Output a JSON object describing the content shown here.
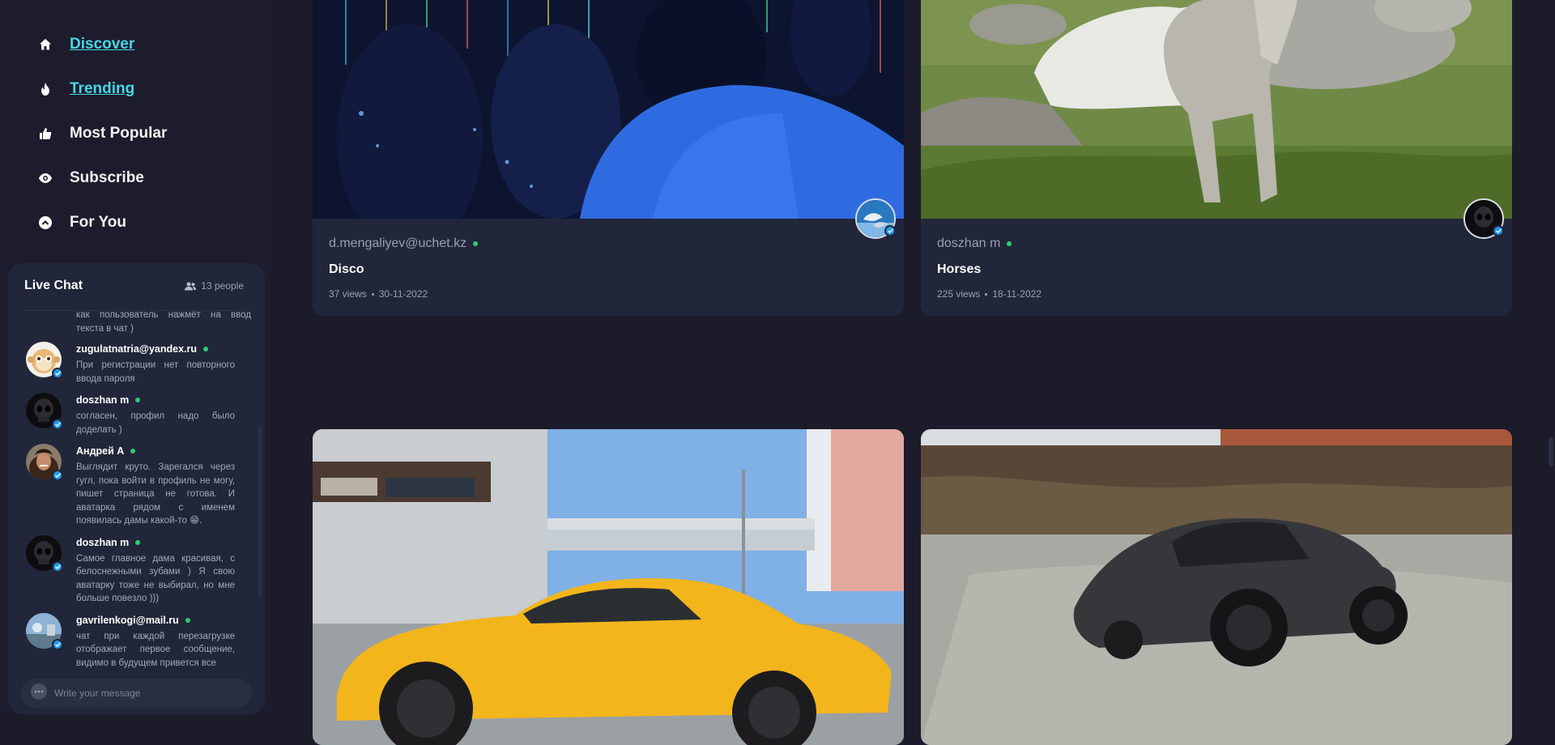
{
  "nav": {
    "items": [
      {
        "label": "Discover",
        "icon": "home-icon"
      },
      {
        "label": "Trending",
        "icon": "flame-icon"
      },
      {
        "label": "Most Popular",
        "icon": "thumbs-up-icon"
      },
      {
        "label": "Subscribe",
        "icon": "eye-icon"
      },
      {
        "label": "For You",
        "icon": "chevron-up-circle-icon"
      }
    ]
  },
  "chat": {
    "title": "Live Chat",
    "people_count": "13 people",
    "fragment": "как пользователь нажмёт на ввод текста в чат )",
    "messages": [
      {
        "user": "zugulatnatria@yandex.ru",
        "text": "При регистрации нет повторного ввода пароля",
        "avatar": "monkey-avatar"
      },
      {
        "user": "doszhan m",
        "text": "согласен, профил надо было доделать )",
        "avatar": "skull-avatar"
      },
      {
        "user": "Андрей А",
        "text": "Выглядит круто. Зарегался через гугл, пока войти в профиль не могу, пишет страница не готова. И аватарка рядом с именем появилась дамы какой-то 😁.",
        "avatar": "woman-avatar"
      },
      {
        "user": "doszhan m",
        "text": "Самое главное дама красивая, с белоснежными зубами ) Я свою аватарку тоже не выбирал, но мне больше повезло )))",
        "avatar": "skull-avatar"
      },
      {
        "user": "gavrilenkogi@mail.ru",
        "text": "чат при каждой перезагрузке отображает первое сообщение, видимо в будущем привется все",
        "avatar": "landscape-avatar"
      }
    ],
    "input_placeholder": "Write your message"
  },
  "cards": [
    {
      "author": "d.mengaliyev@uchet.kz",
      "title": "Disco",
      "views": "37 views",
      "date": "30-11-2022",
      "thumbnail": "disco-crowd-thumbnail"
    },
    {
      "author": "doszhan m",
      "title": "Horses",
      "views": "225 views",
      "date": "18-11-2022",
      "thumbnail": "horses-field-thumbnail"
    },
    {
      "author": "",
      "title": "",
      "views": "",
      "date": "",
      "thumbnail": "yellow-sports-car-thumbnail"
    },
    {
      "author": "",
      "title": "",
      "views": "",
      "date": "",
      "thumbnail": "black-sports-car-thumbnail"
    }
  ],
  "colors": {
    "accent": "#45d6e8",
    "online": "#2ecc71",
    "verified": "#1e9bf0",
    "background": "#1b1b2a",
    "card": "#22263a"
  }
}
